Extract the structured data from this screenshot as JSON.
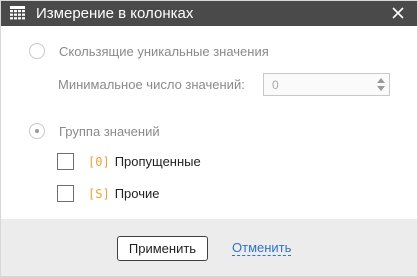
{
  "dialog": {
    "title": "Измерение в колонках",
    "close_icon": "close-icon",
    "title_icon": "grid-columns-icon"
  },
  "options": {
    "sliding_unique": {
      "label": "Скользящие уникальные значения",
      "selected": false,
      "enabled": false
    },
    "min_count": {
      "label": "Минимальное число значений:",
      "value": "0",
      "enabled": false
    },
    "value_group": {
      "label": "Группа значений",
      "selected": true,
      "enabled": false
    }
  },
  "checks": [
    {
      "tag": "[0]",
      "label": "Пропущенные",
      "checked": false
    },
    {
      "tag": "[S]",
      "label": "Прочие",
      "checked": false
    }
  ],
  "footer": {
    "apply_label": "Применить",
    "cancel_label": "Отменить"
  },
  "colors": {
    "titlebar": "#4a4a4a",
    "tag": "#e8a33c",
    "link": "#2d73c8",
    "footer": "#ececec"
  }
}
